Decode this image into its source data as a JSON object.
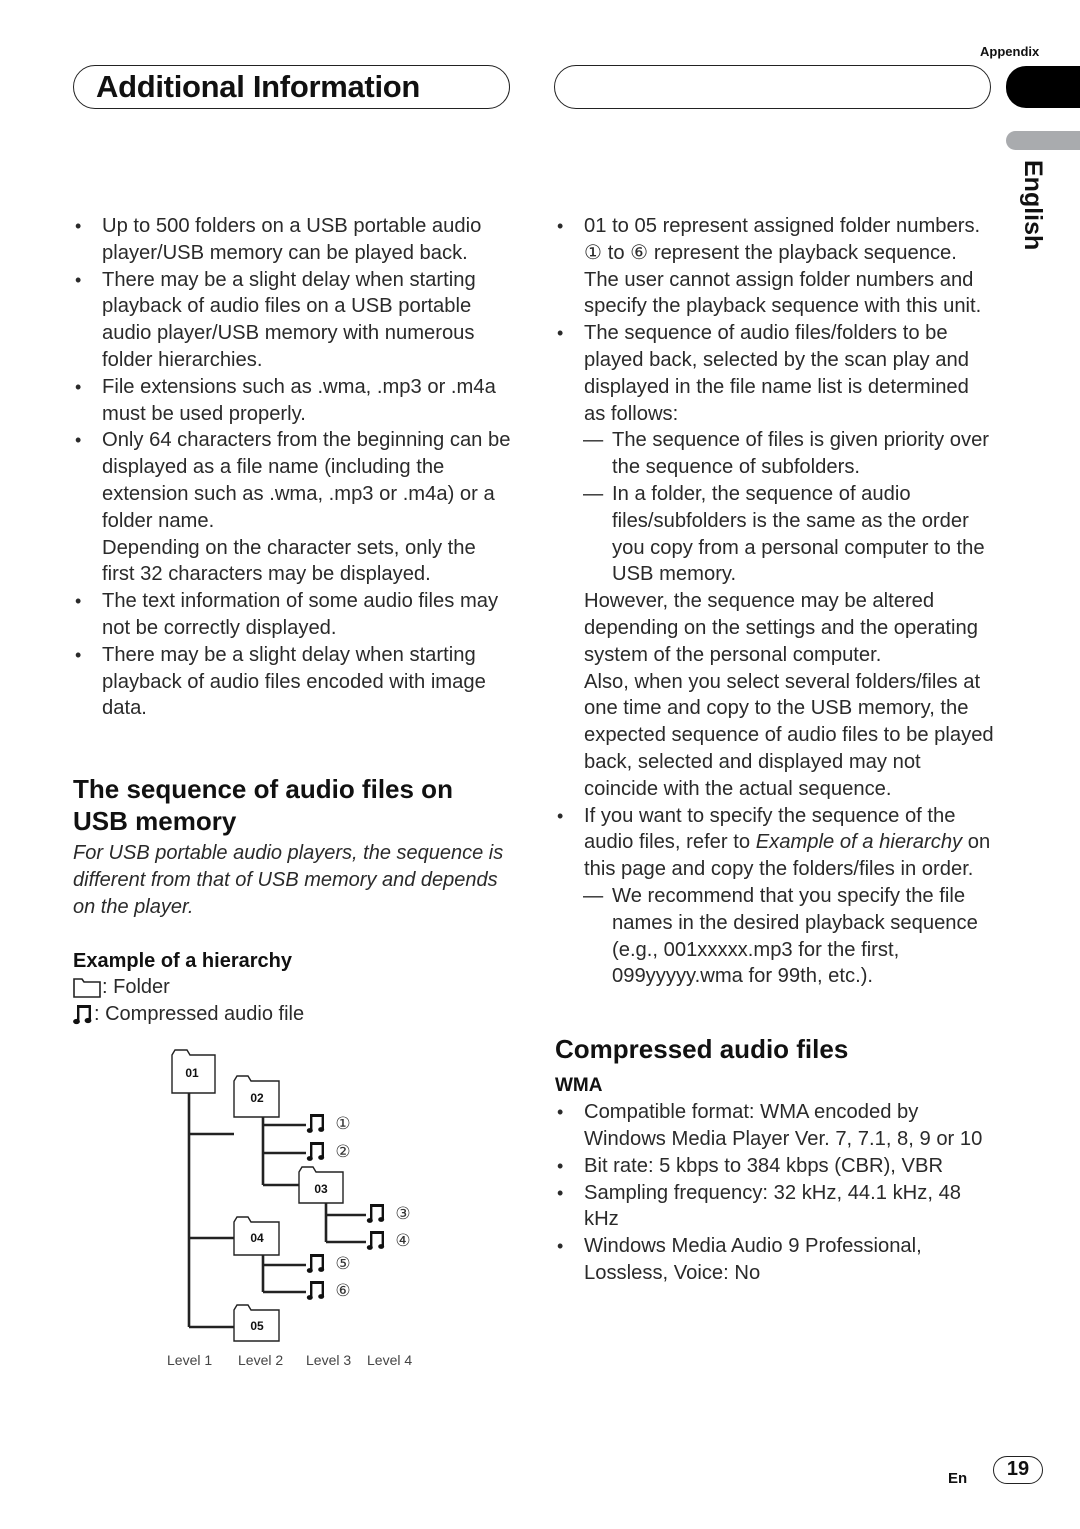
{
  "header": {
    "section_label": "Appendix",
    "title": "Additional Information",
    "language_tab": "English"
  },
  "left_column": {
    "bullets": [
      "Up to 500 folders on a USB portable audio player/USB memory can be played back.",
      "There may be a slight delay when starting playback of audio files on a USB portable audio player/USB memory with numerous folder hierarchies.",
      "File extensions such as .wma, .mp3 or .m4a must be used properly.",
      "Only 64 characters from the beginning can be displayed as a file name (including the extension such as .wma, .mp3 or .m4a) or a folder name."
    ],
    "bullet4_note": "Depending on the character sets, only the first 32 characters may be displayed.",
    "bullets_after": [
      "The text information of some audio files may not be correctly displayed.",
      "There may be a slight delay when starting playback of audio files encoded with image data."
    ],
    "section_heading": "The sequence of audio files on USB memory",
    "section_lead": "For USB portable audio players, the sequence is different from that of USB memory and depends on the player.",
    "example_heading": "Example of a hierarchy",
    "legend": {
      "folder": ": Folder",
      "file": ": Compressed audio file"
    },
    "tree": {
      "folders": [
        "01",
        "02",
        "03",
        "04",
        "05"
      ],
      "sequence_marks": [
        "①",
        "②",
        "③",
        "④",
        "⑤",
        "⑥"
      ],
      "levels": [
        "Level 1",
        "Level 2",
        "Level 3",
        "Level 4"
      ]
    }
  },
  "right_column": {
    "bullet1": "01 to 05 represent assigned folder numbers. ① to ⑥ represent the playback sequence. The user cannot assign folder numbers and specify the playback sequence with this unit.",
    "bullet2": "The sequence of audio files/folders to be played back, selected by the scan play and displayed in the file name list is determined as follows:",
    "dashes": [
      "The sequence of files is given priority over the sequence of subfolders.",
      "In a folder, the sequence of audio files/subfolders is the same as the order you copy from a personal computer to the USB memory."
    ],
    "para1": "However, the sequence may be altered depending on the settings and the operating system of the personal computer.",
    "para2": "Also, when you select several folders/files at one time and copy to the USB memory, the expected sequence of audio files to be played back, selected and displayed may not coincide with the actual sequence.",
    "bullet3_pre": "If you want to specify the sequence of the audio files, refer to ",
    "bullet3_ref": "Example of a hierarchy",
    "bullet3_post": " on this page and copy the folders/files in order.",
    "dash3": "We recommend that you specify the file names in the desired playback sequence (e.g., 001xxxxx.mp3 for the first, 099yyyyy.wma for 99th, etc.).",
    "compressed_heading": "Compressed audio files",
    "wma_heading": "WMA",
    "wma_bullets": [
      "Compatible format: WMA encoded by Windows Media Player Ver. 7, 7.1, 8, 9 or 10",
      "Bit rate: 5 kbps to 384 kbps (CBR), VBR",
      "Sampling frequency: 32 kHz, 44.1 kHz, 48 kHz",
      "Windows Media Audio 9 Professional, Lossless, Voice: No"
    ]
  },
  "footer": {
    "lang_code": "En",
    "page_number": "19"
  }
}
